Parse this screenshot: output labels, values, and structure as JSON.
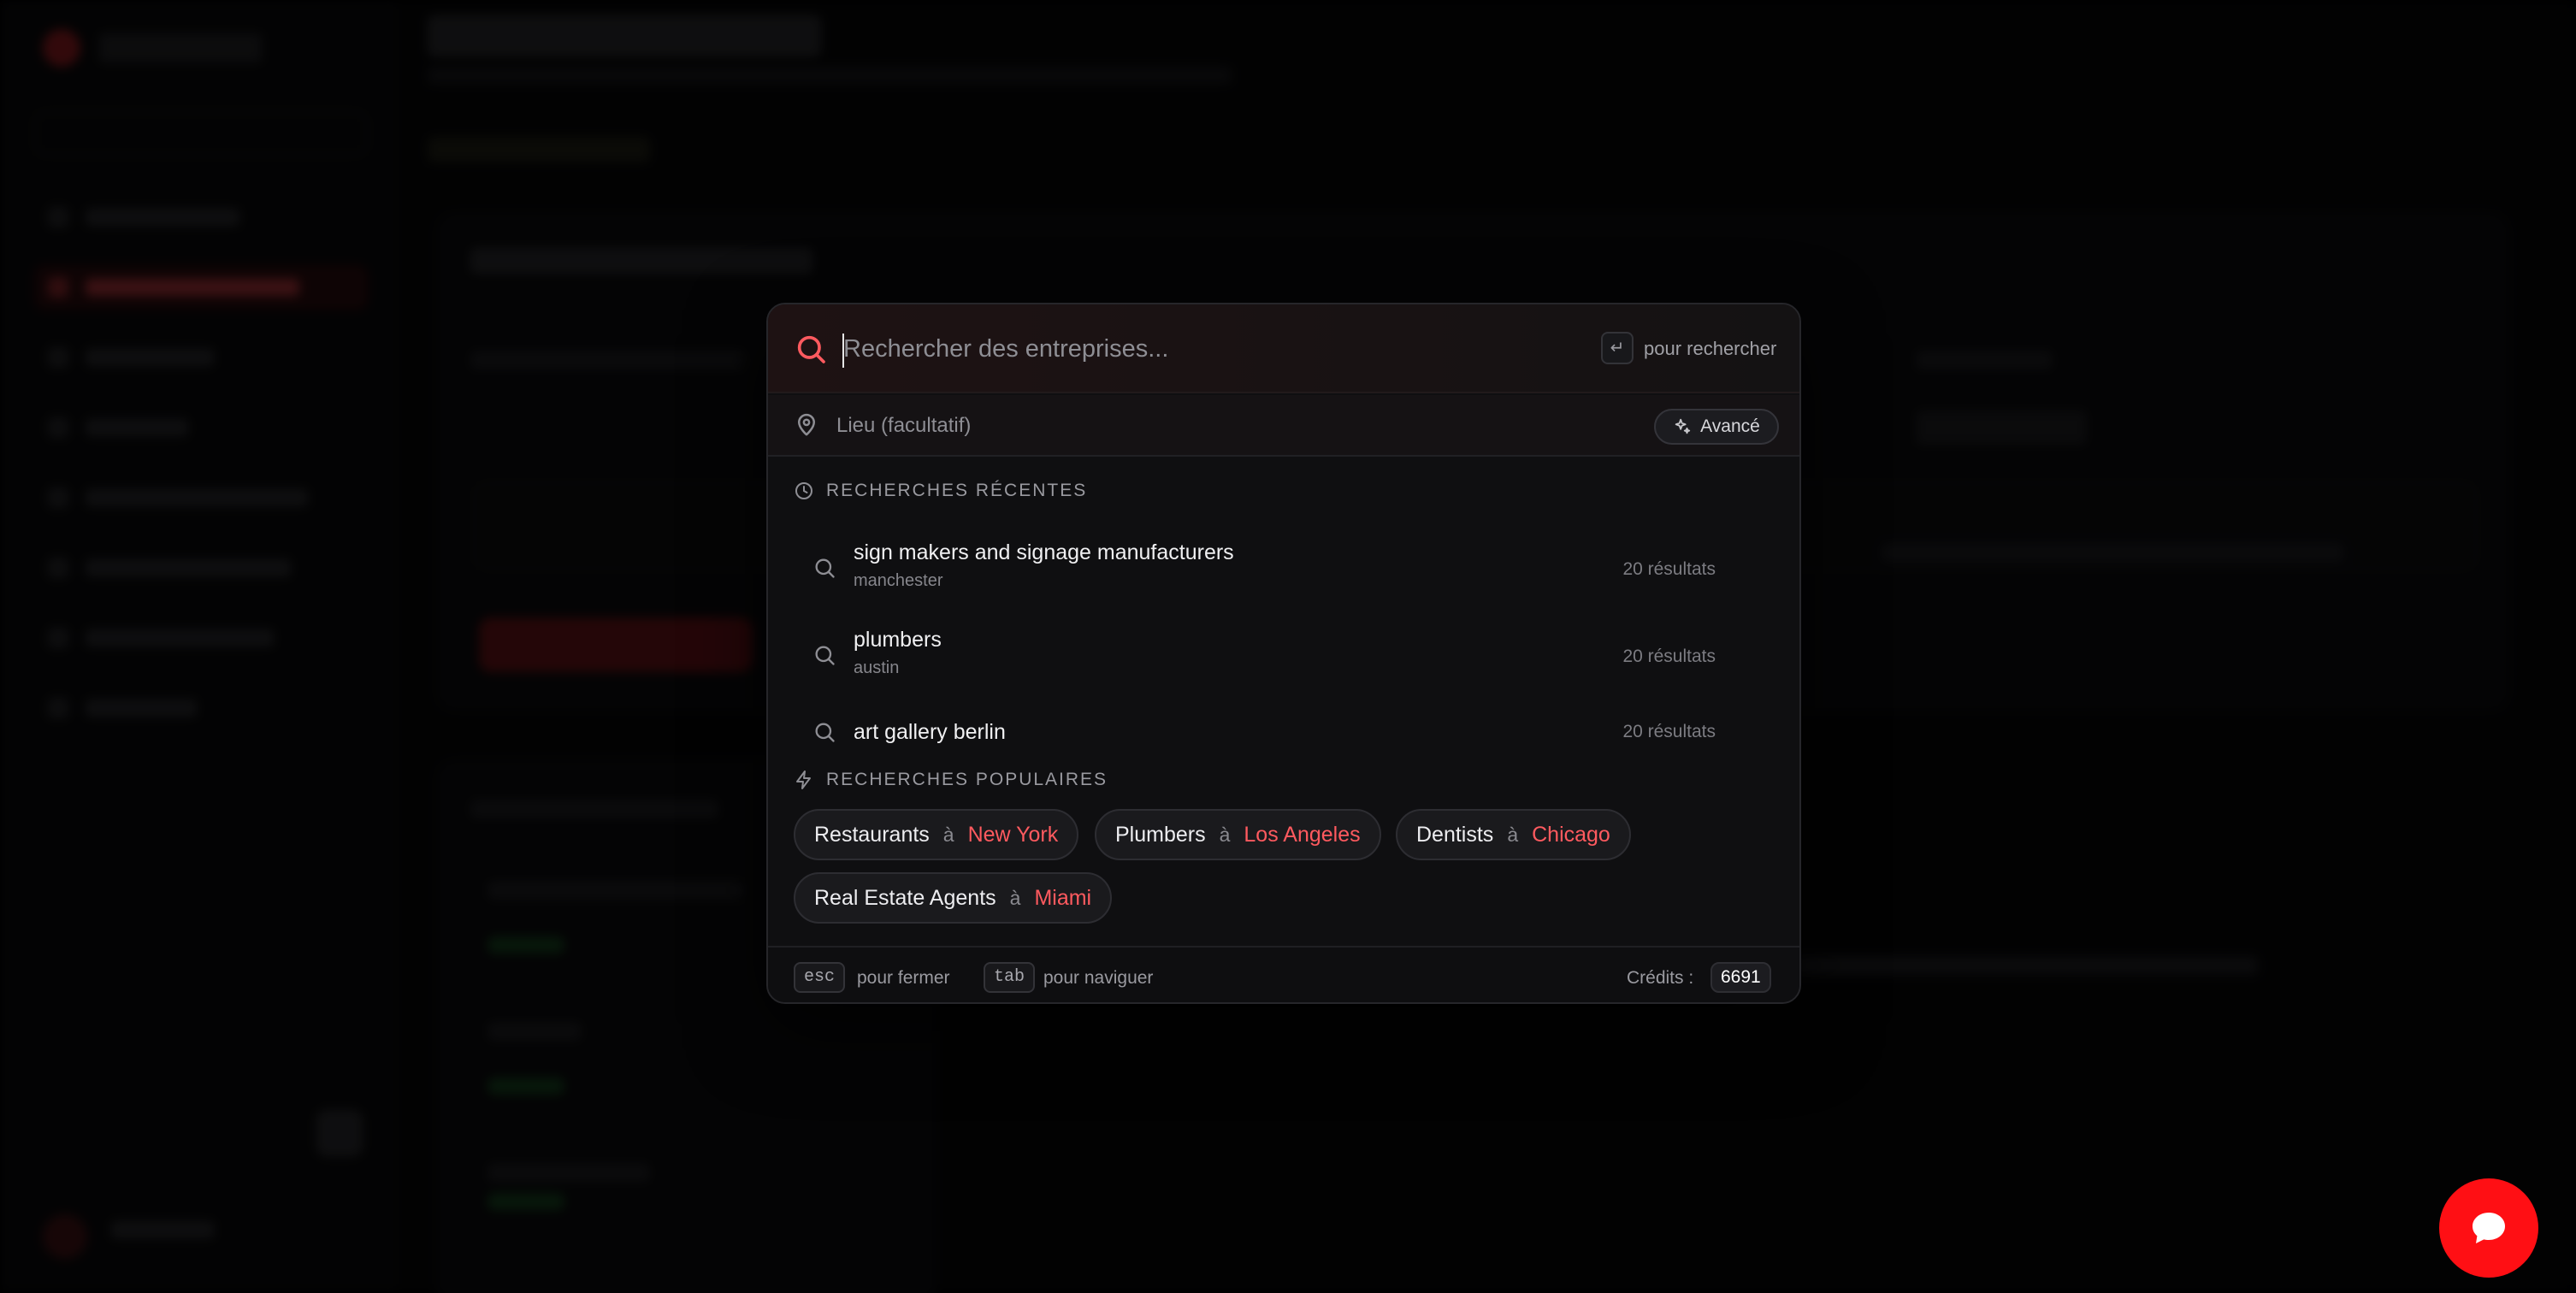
{
  "search": {
    "placeholder": "Rechercher des entreprises...",
    "enter_hint": "pour rechercher",
    "enter_key": "↵",
    "location_placeholder": "Lieu (facultatif)",
    "advanced_label": "Avancé"
  },
  "recent": {
    "heading": "RECHERCHES RÉCENTES",
    "items": [
      {
        "title": "sign makers and signage manufacturers",
        "location": "manchester",
        "count": "20 résultats"
      },
      {
        "title": "plumbers",
        "location": "austin",
        "count": "20 résultats"
      },
      {
        "title": "art gallery berlin",
        "location": "",
        "count": "20 résultats"
      }
    ]
  },
  "popular": {
    "heading": "RECHERCHES POPULAIRES",
    "connector": "à",
    "items": [
      {
        "term": "Restaurants",
        "location": "New York"
      },
      {
        "term": "Plumbers",
        "location": "Los Angeles"
      },
      {
        "term": "Dentists",
        "location": "Chicago"
      },
      {
        "term": "Real Estate Agents",
        "location": "Miami"
      }
    ]
  },
  "footer": {
    "esc_key": "esc",
    "esc_text": "pour fermer",
    "tab_key": "tab",
    "tab_text": "pour naviguer",
    "credits_label": "Crédits :",
    "credits_value": "6691"
  },
  "colors": {
    "accent": "#ff5a5f",
    "chat_button": "#ff0f14",
    "panel": "#0f0f11"
  },
  "icons": {
    "search": "search-icon",
    "location": "map-pin-icon",
    "advanced": "sparkles-icon",
    "recent": "clock-icon",
    "popular": "bolt-icon",
    "chat": "chat-bubble-icon"
  }
}
